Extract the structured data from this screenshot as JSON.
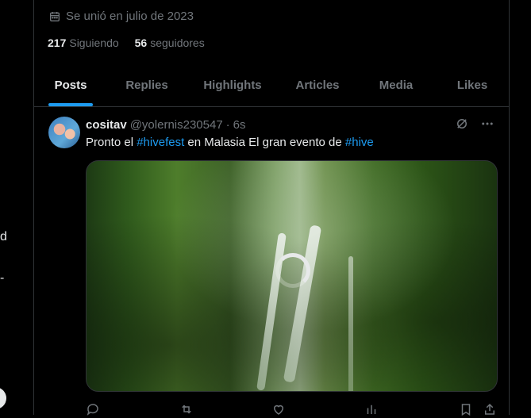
{
  "left_fragments": [
    "d",
    "-"
  ],
  "profile": {
    "joined": "Se unió en julio de 2023",
    "following_count": "217",
    "following_label": "Siguiendo",
    "followers_count": "56",
    "followers_label": "seguidores"
  },
  "tabs": [
    "Posts",
    "Replies",
    "Highlights",
    "Articles",
    "Media",
    "Likes"
  ],
  "active_tab": "Posts",
  "tweet": {
    "name": "cositav",
    "handle": "@yolernis230547",
    "dot": "·",
    "time": "6s",
    "text_before": "Pronto el ",
    "tag1": "#hivefest",
    "text_middle": " en Malasia El gran evento de ",
    "tag2": "#hive",
    "media_state": "loading"
  },
  "colors": {
    "accent": "#1d9bf0",
    "text": "#e7e9ea",
    "muted": "#71767b",
    "border": "#2f3336",
    "bg": "#000000"
  },
  "icons": [
    "calendar-icon",
    "grok-icon",
    "more-icon",
    "reply-icon",
    "retweet-icon",
    "like-icon",
    "views-icon",
    "bookmark-icon",
    "share-icon"
  ]
}
